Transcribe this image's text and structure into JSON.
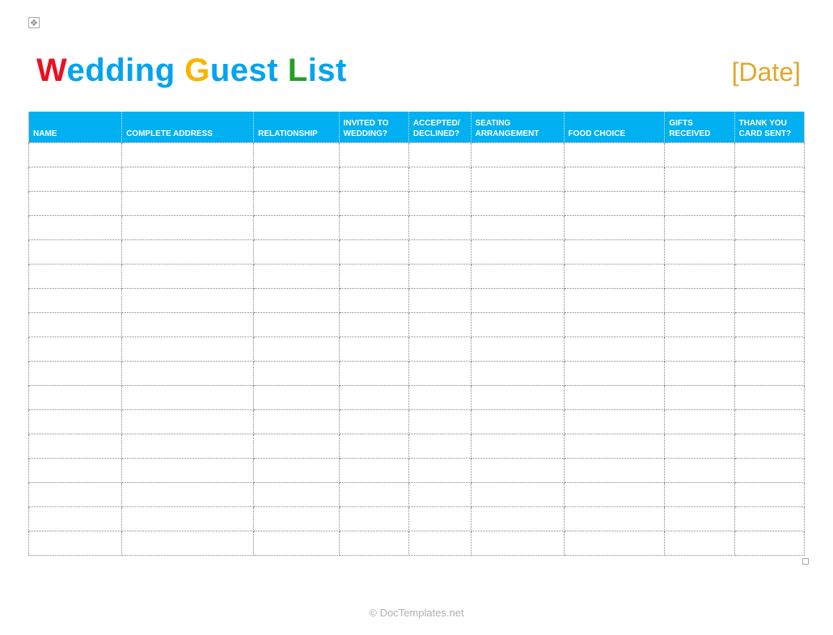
{
  "title": {
    "word1_cap": "W",
    "word1_rest": "edding",
    "word2_cap": "G",
    "word2_rest": "uest",
    "word3_cap": "L",
    "word3_rest": "ist"
  },
  "date_placeholder": "[Date]",
  "columns": {
    "name": "NAME",
    "address": "COMPLETE ADDRESS",
    "relationship": "RELATIONSHIP",
    "invited": "INVITED TO WEDDING?",
    "accepted": "ACCEPTED/ DECLINED?",
    "seating": "SEATING ARRANGEMENT",
    "food": "FOOD CHOICE",
    "gifts": "GIFTS RECEIVED",
    "thank_you": "THANK YOU CARD SENT?"
  },
  "row_count": 17,
  "footer": "© DocTemplates.net"
}
